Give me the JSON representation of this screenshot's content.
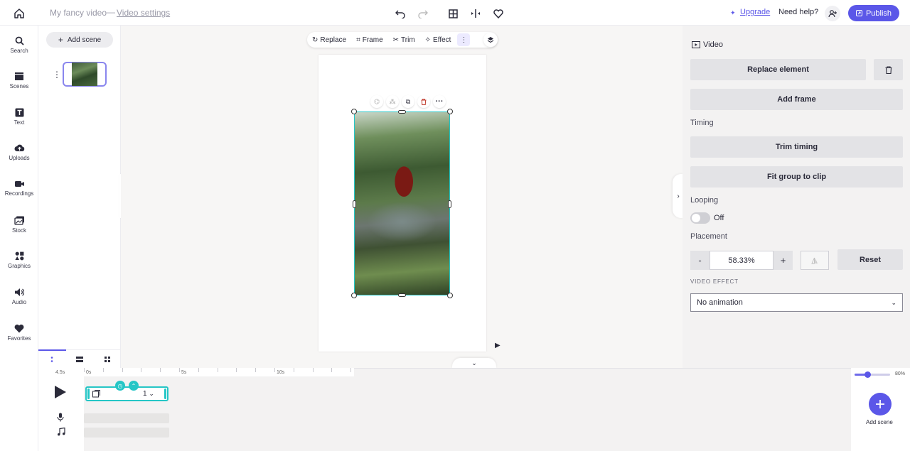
{
  "header": {
    "doc_title": "My fancy video",
    "separator": "—",
    "settings_link": "Video settings",
    "upgrade": "Upgrade",
    "need_help": "Need help?",
    "publish": "Publish"
  },
  "sidebar": {
    "items": [
      {
        "label": "Search",
        "icon": "search-icon"
      },
      {
        "label": "Scenes",
        "icon": "scenes-icon"
      },
      {
        "label": "Text",
        "icon": "text-icon"
      },
      {
        "label": "Uploads",
        "icon": "upload-icon"
      },
      {
        "label": "Recordings",
        "icon": "camera-icon"
      },
      {
        "label": "Stock",
        "icon": "stock-icon"
      },
      {
        "label": "Graphics",
        "icon": "graphics-icon"
      },
      {
        "label": "Audio",
        "icon": "audio-icon"
      },
      {
        "label": "Favorites",
        "icon": "heart-icon"
      }
    ]
  },
  "scenes_panel": {
    "add_scene": "Add scene"
  },
  "canvas_toolbar": {
    "replace": "Replace",
    "frame": "Frame",
    "trim": "Trim",
    "effect": "Effect"
  },
  "right_panel": {
    "heading": "Video",
    "replace_element": "Replace element",
    "add_frame": "Add frame",
    "timing_label": "Timing",
    "trim_timing": "Trim timing",
    "fit_group": "Fit group to clip",
    "looping_label": "Looping",
    "looping_value": "Off",
    "placement_label": "Placement",
    "placement_minus": "-",
    "placement_value": "58.33%",
    "placement_plus": "+",
    "reset": "Reset",
    "video_effect_label": "VIDEO EFFECT",
    "video_effect_value": "No animation"
  },
  "timeline": {
    "duration": "4.5s",
    "ruler": [
      "0s",
      "5s",
      "10s"
    ],
    "clip_count": "1",
    "zoom": "80%",
    "add_scene": "Add scene"
  },
  "colors": {
    "accent": "#5b57e8",
    "selection": "#25c6c6"
  }
}
